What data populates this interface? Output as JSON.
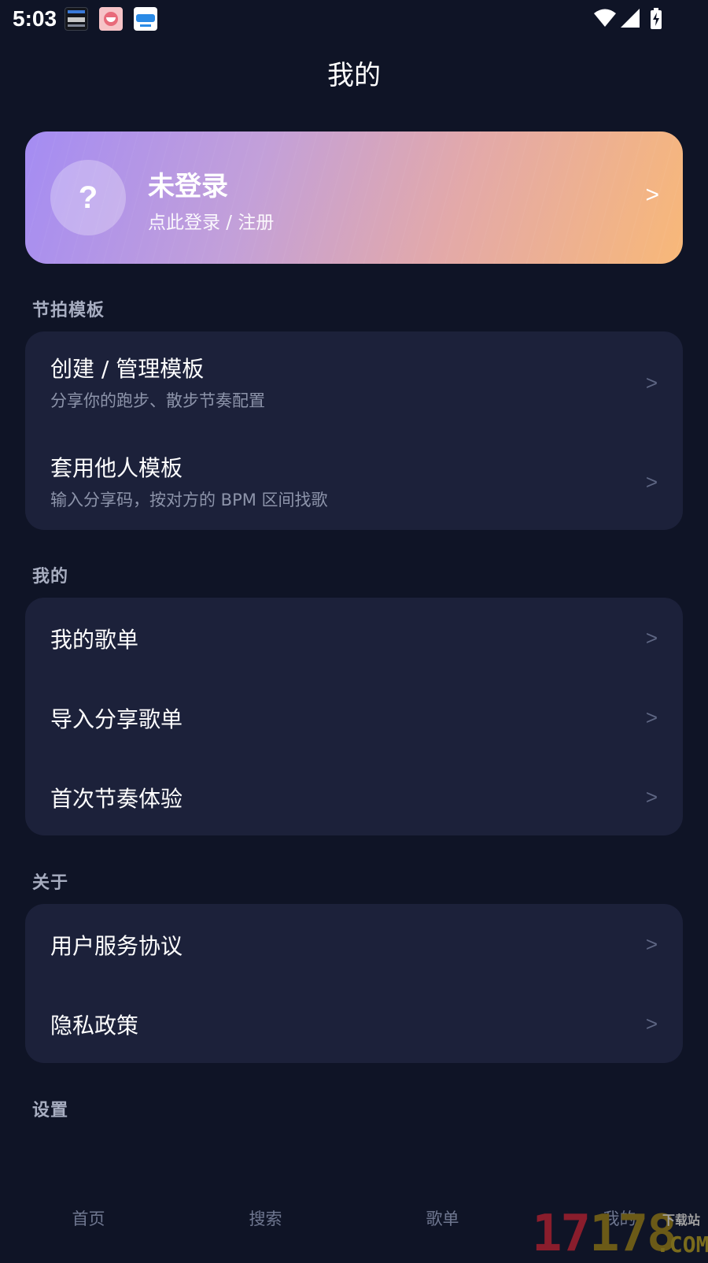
{
  "status_bar": {
    "time": "5:03",
    "notification_icons": [
      "calendar-app-icon",
      "cooking-app-icon",
      "weather-app-icon"
    ],
    "system_icons": [
      "wifi-icon",
      "signal-icon",
      "battery-charging-icon"
    ]
  },
  "header": {
    "title": "我的"
  },
  "profile": {
    "avatar_symbol": "?",
    "name": "未登录",
    "subtitle": "点此登录 / 注册",
    "chevron": ">"
  },
  "sections": {
    "templates": {
      "title": "节拍模板",
      "items": [
        {
          "title": "创建 / 管理模板",
          "subtitle": "分享你的跑步、散步节奏配置",
          "chevron": ">"
        },
        {
          "title": "套用他人模板",
          "subtitle": "输入分享码，按对方的 BPM 区间找歌",
          "chevron": ">"
        }
      ]
    },
    "mine": {
      "title": "我的",
      "items": [
        {
          "title": "我的歌单",
          "chevron": ">"
        },
        {
          "title": "导入分享歌单",
          "chevron": ">"
        },
        {
          "title": "首次节奏体验",
          "chevron": ">"
        }
      ]
    },
    "about": {
      "title": "关于",
      "items": [
        {
          "title": "用户服务协议",
          "chevron": ">"
        },
        {
          "title": "隐私政策",
          "chevron": ">"
        }
      ]
    },
    "settings": {
      "title": "设置"
    }
  },
  "bottom_nav": {
    "items": [
      {
        "label": "首页"
      },
      {
        "label": "搜索"
      },
      {
        "label": "歌单"
      },
      {
        "label": "我的"
      }
    ],
    "active_index": 3
  },
  "watermark": {
    "number": "17178",
    "tagline": "下载站",
    "domain": ".COM"
  },
  "colors": {
    "background": "#0f1426",
    "card": "#1c213a",
    "gradient_start": "#a48cf3",
    "gradient_end": "#f8b878",
    "section_title": "#a7adc0",
    "subtitle": "#8d94aa",
    "nav_inactive": "#6f7790"
  }
}
